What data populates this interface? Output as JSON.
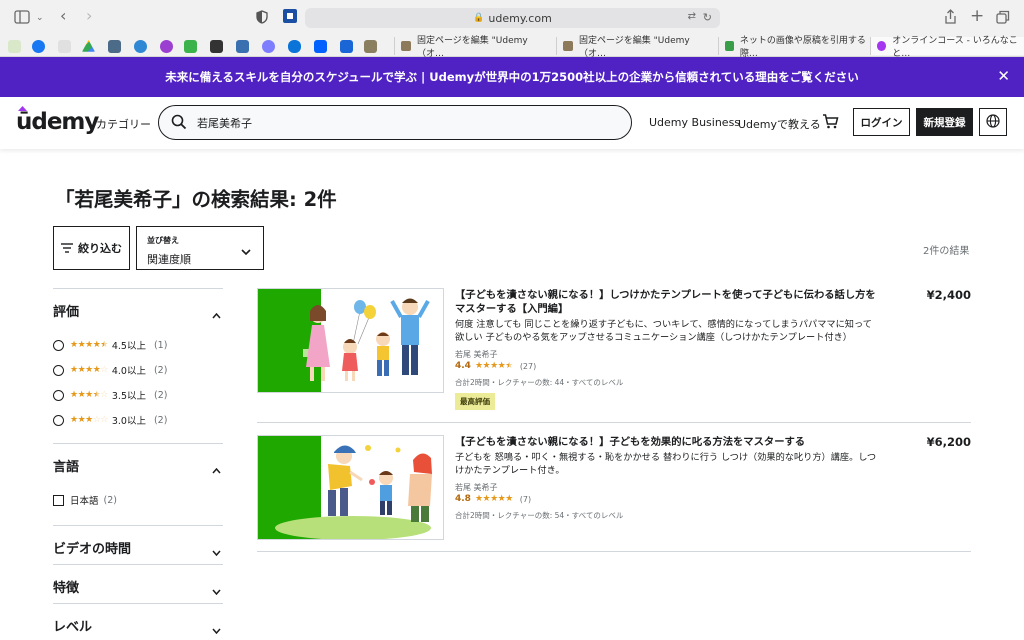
{
  "browser": {
    "url": "udemy.com",
    "tabs": [
      {
        "title": "固定ページを編集 \"Udemy（オ…"
      },
      {
        "title": "固定ページを編集 \"Udemy（オ…"
      },
      {
        "title": "ネットの画像や原稿を引用する際…"
      },
      {
        "title": "オンラインコース - いろんなこと…"
      }
    ]
  },
  "banner": {
    "text": "未来に備えるスキルを自分のスケジュールで学ぶ | Udemyが世界中の1万2500社以上の企業から信頼されている理由をご覧ください"
  },
  "header": {
    "logo": "ūdemy",
    "categories": "カテゴリー",
    "search_value": "若尾美希子",
    "business": "Udemy Business",
    "teach": "Udemyで教える",
    "login": "ログイン",
    "signup": "新規登録"
  },
  "results": {
    "title": "「若尾美希子」の検索結果: 2件",
    "filter_button": "絞り込む",
    "sort_label": "並び替え",
    "sort_value": "関連度順",
    "count": "2件の結果"
  },
  "filters": {
    "rating": {
      "heading": "評価",
      "options": [
        {
          "label": "4.5以上",
          "count": "(1)",
          "stars": 4.5
        },
        {
          "label": "4.0以上",
          "count": "(2)",
          "stars": 4.0
        },
        {
          "label": "3.5以上",
          "count": "(2)",
          "stars": 3.5
        },
        {
          "label": "3.0以上",
          "count": "(2)",
          "stars": 3.0
        }
      ]
    },
    "language": {
      "heading": "言語",
      "options": [
        {
          "label": "日本語",
          "count": "(2)"
        }
      ]
    },
    "video_duration": {
      "heading": "ビデオの時間"
    },
    "features": {
      "heading": "特徴"
    },
    "level": {
      "heading": "レベル"
    }
  },
  "courses": [
    {
      "title": "【子どもを潰さない親になる！】しつけかたテンプレートを使って子どもに伝わる話し方をマスターする【入門編】",
      "description": "何度 注意しても 同じことを繰り返す子どもに、ついキレて、感情的になってしまうパパママに知って欲しい 子どものやる気をアップさせるコミュニケーション講座（しつけかたテンプレート付き）",
      "instructor": "若尾 美希子",
      "rating": "4.4",
      "rating_value": 4.4,
      "rating_count": "(27)",
      "meta": "合計2時間・レクチャーの数: 44・すべてのレベル",
      "badge": "最高評価",
      "price": "¥2,400"
    },
    {
      "title": "【子どもを潰さない親になる！】子どもを効果的に叱る方法をマスターする",
      "description": "子どもを 怒鳴る・叩く・無視する・恥をかかせる 替わりに行う しつけ（効果的な叱り方）講座。しつけかたテンプレート付き。",
      "instructor": "若尾 美希子",
      "rating": "4.8",
      "rating_value": 4.8,
      "rating_count": "(7)",
      "meta": "合計2時間・レクチャーの数: 54・すべてのレベル",
      "price": "¥6,200"
    }
  ],
  "colors": {
    "brand_purple": "#5022c3",
    "logo_purple": "#a435f0",
    "star": "#e59819",
    "rating_num": "#b4690e",
    "badge_bg": "#eceb98",
    "thumb_green": "#1ea800"
  }
}
